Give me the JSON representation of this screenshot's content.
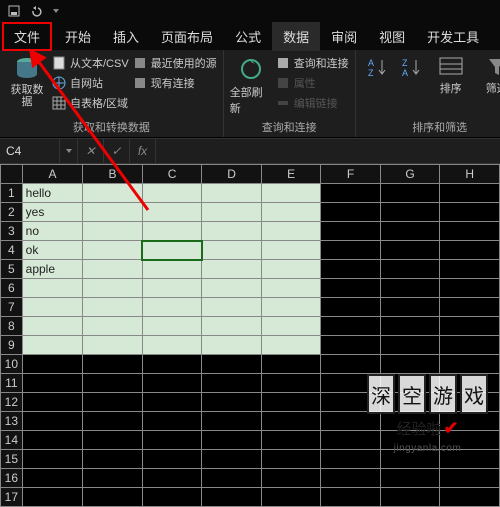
{
  "menubar": [
    "文件",
    "开始",
    "插入",
    "页面布局",
    "公式",
    "数据",
    "审阅",
    "视图",
    "开发工具"
  ],
  "active_tab": "数据",
  "ribbon": {
    "g1": {
      "big": "获取数\n据",
      "items": [
        "从文本/CSV",
        "自网站",
        "自表格/区域",
        "最近使用的源",
        "现有连接"
      ],
      "label": "获取和转换数据"
    },
    "g2": {
      "big": "全部刷新",
      "items": [
        "查询和连接",
        "属性",
        "编辑链接"
      ],
      "label": "查询和连接"
    },
    "g3": {
      "big": "排序",
      "big2": "筛选",
      "label": "排序和筛选"
    }
  },
  "namebox": "C4",
  "fx": "fx",
  "cols": [
    "A",
    "B",
    "C",
    "D",
    "E",
    "F",
    "G",
    "H"
  ],
  "rows": [
    "1",
    "2",
    "3",
    "4",
    "5",
    "6",
    "7",
    "8",
    "9",
    "10",
    "11",
    "12",
    "13",
    "14",
    "15",
    "16",
    "17"
  ],
  "cells": {
    "A1": "hello",
    "A2": "yes",
    "A3": "no",
    "A4": "ok",
    "A5": "apple"
  },
  "watermark": {
    "chars": [
      "深",
      "空",
      "游",
      "戏"
    ],
    "text": "经验啦",
    "url": "jingyanla.com"
  }
}
